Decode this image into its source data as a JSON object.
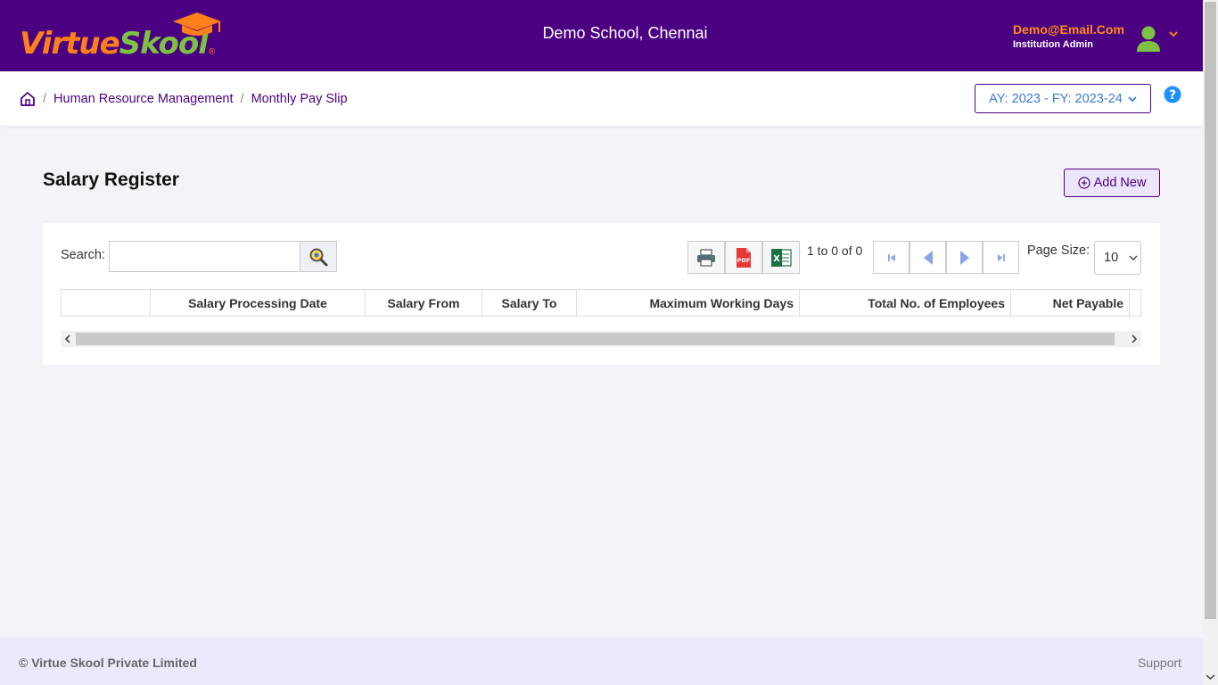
{
  "app": {
    "logo": {
      "part1": "Virtue",
      "part2": "Skool",
      "reg": "®"
    },
    "school_name": "Demo School, Chennai",
    "user": {
      "email": "Demo@Email.Com",
      "role": "Institution Admin"
    }
  },
  "breadcrumb": {
    "items": [
      "Human Resource Management",
      "Monthly Pay Slip"
    ],
    "separator": "/"
  },
  "academic_year": {
    "selected": "AY: 2023 - FY: 2023-24"
  },
  "page": {
    "title": "Salary Register",
    "add_new_label": "Add New"
  },
  "grid": {
    "search_label": "Search:",
    "search_value": "",
    "range_text": "1 to 0 of 0",
    "page_size_label": "Page Size:",
    "page_size_value": "10",
    "columns": [
      "",
      "Salary Processing Date",
      "Salary From",
      "Salary To",
      "Maximum Working Days",
      "Total No. of Employees",
      "Net Payable"
    ],
    "rows": []
  },
  "footer": {
    "copyright": "© Virtue Skool Private Limited",
    "support": "Support"
  },
  "colors": {
    "brand_purple": "#4b0082",
    "brand_orange": "#ff7f1a",
    "brand_green": "#7dc242",
    "link_blue": "#3a7bd5"
  },
  "icons": [
    "graduation-cap-icon",
    "user-avatar-icon",
    "chevron-down-icon",
    "home-icon",
    "help-icon",
    "add-circle-icon",
    "search-icon",
    "print-icon",
    "pdf-icon",
    "excel-icon",
    "first-page-icon",
    "previous-page-icon",
    "next-page-icon",
    "last-page-icon"
  ]
}
